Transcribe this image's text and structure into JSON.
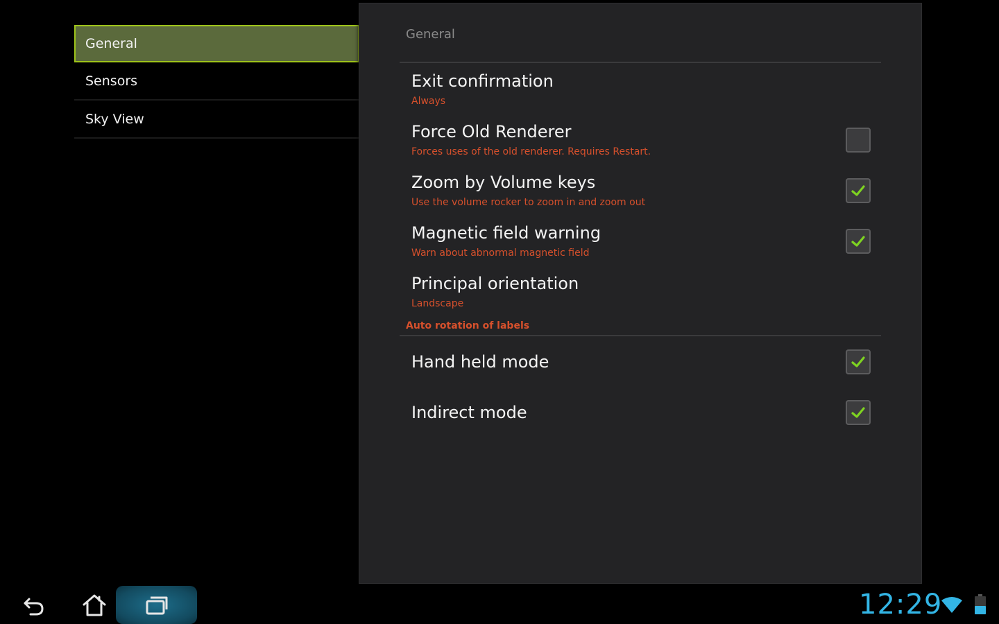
{
  "headers": {
    "items": [
      {
        "label": "General",
        "selected": true
      },
      {
        "label": "Sensors",
        "selected": false
      },
      {
        "label": "Sky View",
        "selected": false
      }
    ]
  },
  "panel": {
    "title": "General",
    "preferences": [
      {
        "title": "Exit confirmation",
        "summary": "Always",
        "has_checkbox": false
      },
      {
        "title": "Force Old Renderer",
        "summary": "Forces uses of the old renderer. Requires Restart.",
        "has_checkbox": true,
        "checked": false
      },
      {
        "title": "Zoom by Volume keys",
        "summary": "Use the volume rocker to zoom in and zoom out",
        "has_checkbox": true,
        "checked": true
      },
      {
        "title": "Magnetic field warning",
        "summary": "Warn about abnormal magnetic field",
        "has_checkbox": true,
        "checked": true
      },
      {
        "title": "Principal orientation",
        "summary": "Landscape",
        "has_checkbox": false
      }
    ],
    "category": {
      "label": "Auto rotation of labels",
      "preferences": [
        {
          "title": "Hand held mode",
          "has_checkbox": true,
          "checked": true
        },
        {
          "title": "Indirect mode",
          "has_checkbox": true,
          "checked": true
        }
      ]
    }
  },
  "system_bar": {
    "clock": "12:29",
    "icons": [
      "back-icon",
      "home-icon",
      "recents-icon",
      "wifi-icon",
      "battery-icon"
    ]
  },
  "colors": {
    "accent_green": "#9ec31a",
    "summary_orange": "#d6502c",
    "clock_blue": "#33b5e5",
    "check_green": "#7ed321"
  }
}
